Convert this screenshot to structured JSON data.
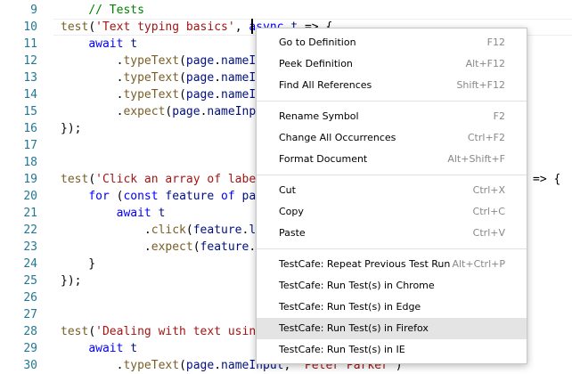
{
  "editor": {
    "lines": [
      {
        "n": "9",
        "tokens": [
          {
            "t": "    "
          },
          {
            "t": "// Tests",
            "c": "comment"
          }
        ]
      },
      {
        "n": "10",
        "tokens": [
          {
            "t": "test",
            "c": "fn"
          },
          {
            "t": "("
          },
          {
            "t": "'Text typing basics'",
            "c": "str"
          },
          {
            "t": ", "
          },
          {
            "t": "async",
            "c": "kw"
          },
          {
            "t": " "
          },
          {
            "t": "t",
            "c": "id"
          },
          {
            "t": " => {"
          }
        ]
      },
      {
        "n": "11",
        "tokens": [
          {
            "t": "    "
          },
          {
            "t": "await",
            "c": "kw"
          },
          {
            "t": " "
          },
          {
            "t": "t",
            "c": "id"
          }
        ]
      },
      {
        "n": "12",
        "tokens": [
          {
            "t": "        ."
          },
          {
            "t": "typeText",
            "c": "fn"
          },
          {
            "t": "("
          },
          {
            "t": "page",
            "c": "id"
          },
          {
            "t": "."
          },
          {
            "t": "nameIn",
            "c": "id"
          }
        ]
      },
      {
        "n": "13",
        "tokens": [
          {
            "t": "        ."
          },
          {
            "t": "typeText",
            "c": "fn"
          },
          {
            "t": "("
          },
          {
            "t": "page",
            "c": "id"
          },
          {
            "t": "."
          },
          {
            "t": "nameIn",
            "c": "id"
          }
        ]
      },
      {
        "n": "14",
        "tokens": [
          {
            "t": "        ."
          },
          {
            "t": "typeText",
            "c": "fn"
          },
          {
            "t": "("
          },
          {
            "t": "page",
            "c": "id"
          },
          {
            "t": "."
          },
          {
            "t": "nameIn",
            "c": "id"
          }
        ]
      },
      {
        "n": "15",
        "tokens": [
          {
            "t": "        ."
          },
          {
            "t": "expect",
            "c": "fn"
          },
          {
            "t": "("
          },
          {
            "t": "page",
            "c": "id"
          },
          {
            "t": "."
          },
          {
            "t": "nameInpu",
            "c": "id"
          }
        ]
      },
      {
        "n": "16",
        "tokens": [
          {
            "t": "});"
          }
        ]
      },
      {
        "n": "17",
        "tokens": []
      },
      {
        "n": "18",
        "tokens": []
      },
      {
        "n": "19",
        "tokens": [
          {
            "t": "test",
            "c": "fn"
          },
          {
            "t": "("
          },
          {
            "t": "'Click an array of label",
            "c": "str"
          }
        ]
      },
      {
        "n": "20",
        "tokens": [
          {
            "t": "    "
          },
          {
            "t": "for",
            "c": "kw"
          },
          {
            "t": " ("
          },
          {
            "t": "const",
            "c": "kw"
          },
          {
            "t": " "
          },
          {
            "t": "feature",
            "c": "id"
          },
          {
            "t": " "
          },
          {
            "t": "of",
            "c": "kw"
          },
          {
            "t": " "
          },
          {
            "t": "pag",
            "c": "id"
          }
        ]
      },
      {
        "n": "21",
        "tokens": [
          {
            "t": "        "
          },
          {
            "t": "await",
            "c": "kw"
          },
          {
            "t": " "
          },
          {
            "t": "t",
            "c": "id"
          }
        ]
      },
      {
        "n": "22",
        "tokens": [
          {
            "t": "            ."
          },
          {
            "t": "click",
            "c": "fn"
          },
          {
            "t": "("
          },
          {
            "t": "feature",
            "c": "id"
          },
          {
            "t": "."
          },
          {
            "t": "la",
            "c": "id"
          }
        ]
      },
      {
        "n": "23",
        "tokens": [
          {
            "t": "            ."
          },
          {
            "t": "expect",
            "c": "fn"
          },
          {
            "t": "("
          },
          {
            "t": "feature",
            "c": "id"
          },
          {
            "t": ".c"
          }
        ]
      },
      {
        "n": "24",
        "tokens": [
          {
            "t": "    }"
          }
        ]
      },
      {
        "n": "25",
        "tokens": [
          {
            "t": "});"
          }
        ]
      },
      {
        "n": "26",
        "tokens": []
      },
      {
        "n": "27",
        "tokens": []
      },
      {
        "n": "28",
        "tokens": [
          {
            "t": "test",
            "c": "fn"
          },
          {
            "t": "("
          },
          {
            "t": "'Dealing with text using",
            "c": "str"
          }
        ]
      },
      {
        "n": "29",
        "tokens": [
          {
            "t": "    "
          },
          {
            "t": "await",
            "c": "kw"
          },
          {
            "t": " "
          },
          {
            "t": "t",
            "c": "id"
          }
        ]
      },
      {
        "n": "30",
        "tokens": [
          {
            "t": "        ."
          },
          {
            "t": "typeText",
            "c": "fn"
          },
          {
            "t": "("
          },
          {
            "t": "page",
            "c": "id"
          },
          {
            "t": "."
          },
          {
            "t": "nameInput",
            "c": "id"
          },
          {
            "t": ", "
          },
          {
            "t": "'Peter Parker'",
            "c": "str"
          },
          {
            "t": ")"
          }
        ]
      }
    ],
    "line19_tail": "=> {"
  },
  "context_menu": {
    "groups": [
      [
        {
          "label": "Go to Definition",
          "shortcut": "F12"
        },
        {
          "label": "Peek Definition",
          "shortcut": "Alt+F12"
        },
        {
          "label": "Find All References",
          "shortcut": "Shift+F12"
        }
      ],
      [
        {
          "label": "Rename Symbol",
          "shortcut": "F2"
        },
        {
          "label": "Change All Occurrences",
          "shortcut": "Ctrl+F2"
        },
        {
          "label": "Format Document",
          "shortcut": "Alt+Shift+F"
        }
      ],
      [
        {
          "label": "Cut",
          "shortcut": "Ctrl+X"
        },
        {
          "label": "Copy",
          "shortcut": "Ctrl+C"
        },
        {
          "label": "Paste",
          "shortcut": "Ctrl+V"
        }
      ],
      [
        {
          "label": "TestCafe: Repeat Previous Test Run",
          "shortcut": "Alt+Ctrl+P"
        },
        {
          "label": "TestCafe: Run Test(s) in Chrome",
          "shortcut": ""
        },
        {
          "label": "TestCafe: Run Test(s) in Edge",
          "shortcut": ""
        },
        {
          "label": "TestCafe: Run Test(s) in Firefox",
          "shortcut": "",
          "highlighted": true
        },
        {
          "label": "TestCafe: Run Test(s) in IE",
          "shortcut": ""
        }
      ]
    ]
  },
  "colors": {
    "line_number": "#237893",
    "comment": "#008000",
    "keyword": "#0000ff",
    "string": "#a31515",
    "menu_highlight": "#e4e4e4"
  }
}
